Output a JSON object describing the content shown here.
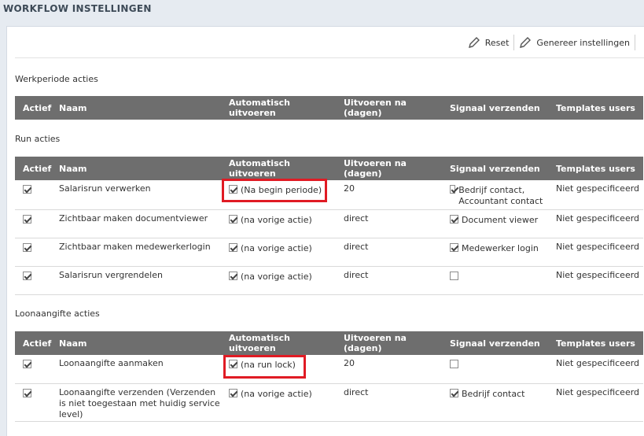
{
  "page": {
    "title": "WORKFLOW INSTELLINGEN"
  },
  "toolbar": {
    "reset_label": "Reset",
    "generate_label": "Genereer instellingen"
  },
  "columns": [
    "Actief",
    "Naam",
    "Automatisch uitvoeren",
    "Uitvoeren na (dagen)",
    "Signaal verzenden",
    "Templates users"
  ],
  "sections": {
    "werkperiode": {
      "label": "Werkperiode acties"
    },
    "run": {
      "label": "Run acties",
      "rows": [
        {
          "actief": true,
          "naam": "Salarisrun verwerken",
          "auto_checked": true,
          "auto_label": "(Na begin periode)",
          "dagen": "20",
          "signaal_checked": true,
          "signaal_label": "Bedrijf contact, Accountant contact",
          "templates": "Niet gespecificeerd"
        },
        {
          "actief": true,
          "naam": "Zichtbaar maken documentviewer",
          "auto_checked": true,
          "auto_label": "(na vorige actie)",
          "dagen": "direct",
          "signaal_checked": true,
          "signaal_label": "Document viewer",
          "templates": "Niet gespecificeerd"
        },
        {
          "actief": true,
          "naam": "Zichtbaar maken medewerkerlogin",
          "auto_checked": true,
          "auto_label": "(na vorige actie)",
          "dagen": "direct",
          "signaal_checked": true,
          "signaal_label": "Medewerker login",
          "templates": "Niet gespecificeerd"
        },
        {
          "actief": true,
          "naam": "Salarisrun vergrendelen",
          "auto_checked": true,
          "auto_label": "(na vorige actie)",
          "dagen": "direct",
          "signaal_checked": false,
          "signaal_label": "",
          "templates": "Niet gespecificeerd"
        }
      ]
    },
    "loonaangifte": {
      "label": "Loonaangifte acties",
      "rows": [
        {
          "actief": true,
          "naam": "Loonaangifte aanmaken",
          "auto_checked": true,
          "auto_label": "(na run lock)",
          "dagen": "20",
          "signaal_checked": false,
          "signaal_label": "",
          "templates": "Niet gespecificeerd"
        },
        {
          "actief": true,
          "naam": "Loonaangifte verzenden (Verzenden is niet toegestaan met huidig service level)",
          "auto_checked": true,
          "auto_label": "(na vorige actie)",
          "dagen": "direct",
          "signaal_checked": true,
          "signaal_label": "Bedrijf contact",
          "templates": "Niet gespecificeerd"
        }
      ]
    }
  },
  "colors": {
    "header_bg": "#6e6e6e",
    "highlight": "#e01b24",
    "page_bg": "#e6ebf1"
  },
  "icons": {
    "reset": "pencil-icon",
    "generate": "pencil-icon"
  }
}
